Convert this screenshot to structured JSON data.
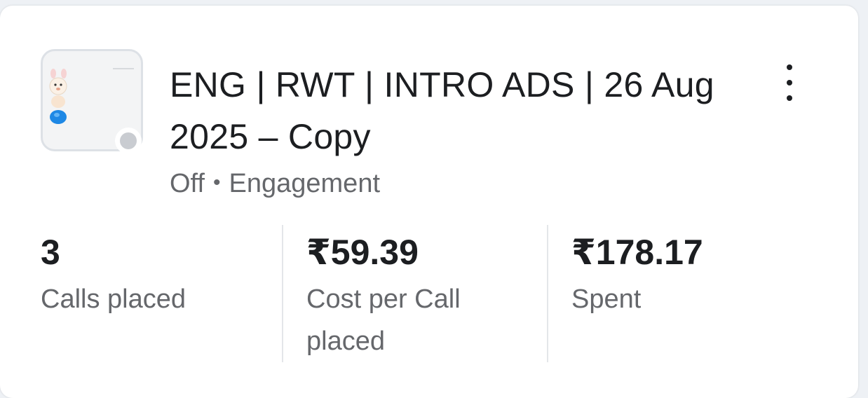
{
  "campaign": {
    "title": "ENG | RWT | INTRO ADS | 26 Aug 2025 – Copy",
    "status": "Off",
    "objective": "Engagement",
    "separator": "•"
  },
  "thumbnail": {
    "icon": "ad-creative-thumbnail",
    "status_color": "#c9ccd1"
  },
  "menu": {
    "icon": "more-vertical-icon"
  },
  "metrics": [
    {
      "value": "3",
      "label": "Calls placed"
    },
    {
      "value": "₹59.39",
      "label": "Cost per Call placed"
    },
    {
      "value": "₹178.17",
      "label": "Spent"
    }
  ],
  "colors": {
    "text_primary": "#1c1e21",
    "text_secondary": "#65676b",
    "background": "#eef1f5",
    "card": "#ffffff"
  }
}
